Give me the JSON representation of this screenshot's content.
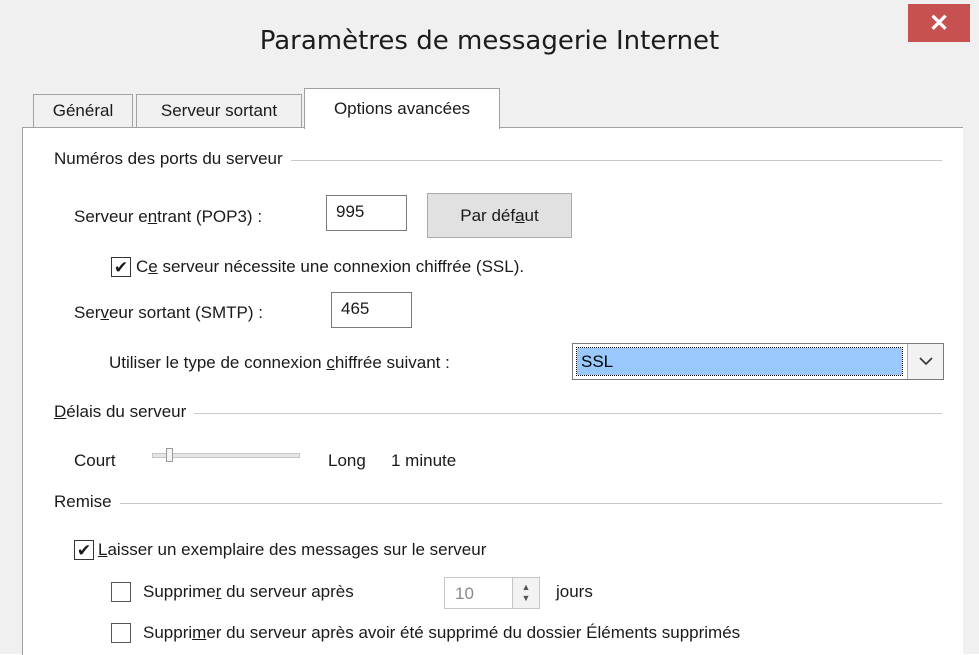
{
  "window": {
    "title": "Paramètres de messagerie Internet",
    "close_symbol": "✕"
  },
  "tabs": [
    {
      "label": "Général",
      "active": false
    },
    {
      "label": "Serveur sortant",
      "active": false
    },
    {
      "label": "Options avancées",
      "active": true
    }
  ],
  "ports": {
    "group_label": "Numéros des ports du serveur",
    "incoming_label": "Serveur entrant (POP3) :",
    "incoming_value": "995",
    "default_button": "Par défaut",
    "ssl_required_label": "Ce serveur nécessite une connexion chiffrée (SSL).",
    "ssl_required_checked": true,
    "outgoing_label": "Serveur sortant (SMTP) :",
    "outgoing_value": "465",
    "encryption_label": "Utiliser le type de connexion chiffrée suivant :",
    "encryption_value": "SSL"
  },
  "timeouts": {
    "group_label": "Délais du serveur",
    "short_label": "Court",
    "long_label": "Long",
    "value_label": "1 minute"
  },
  "delivery": {
    "group_label": "Remise",
    "leave_copy_label": "Laisser un exemplaire des messages sur le serveur",
    "leave_copy_checked": true,
    "remove_after_label": "Supprimer du serveur après",
    "remove_after_checked": false,
    "remove_after_days": "10",
    "days_label": "jours",
    "remove_deleted_label": "Supprimer du serveur après avoir été supprimé du dossier Éléments supprimés",
    "remove_deleted_checked": false
  },
  "icons": {
    "check": "✔",
    "dropdown": "chevron-down-icon",
    "spinner_up": "▲",
    "spinner_down": "▼"
  }
}
